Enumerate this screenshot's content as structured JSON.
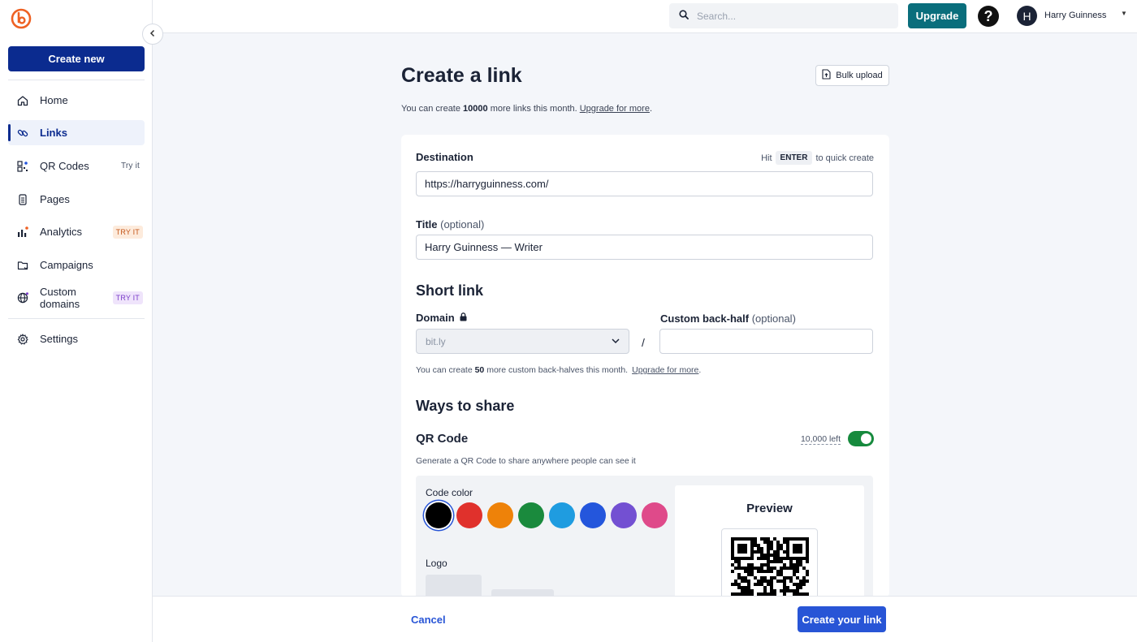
{
  "sidebar": {
    "create_label": "Create new",
    "items": [
      {
        "label": "Home",
        "icon": "home-icon"
      },
      {
        "label": "Links",
        "icon": "link-icon",
        "active": true
      },
      {
        "label": "QR Codes",
        "icon": "qr-code-icon",
        "badge": "Try it"
      },
      {
        "label": "Pages",
        "icon": "page-icon"
      },
      {
        "label": "Analytics",
        "icon": "chart-icon",
        "badge": "TRY IT"
      },
      {
        "label": "Campaigns",
        "icon": "campaign-icon"
      },
      {
        "label": "Custom domains",
        "icon": "globe-icon",
        "badge": "TRY IT"
      },
      {
        "label": "Settings",
        "icon": "gear-icon"
      }
    ]
  },
  "header": {
    "search_placeholder": "Search...",
    "upgrade_label": "Upgrade",
    "help_glyph": "?",
    "avatar_initial": "H",
    "user_name": "Harry Guinness"
  },
  "main": {
    "title": "Create a link",
    "bulk_upload_label": "Bulk upload",
    "quota": {
      "prefix": "You can create ",
      "count": "10000",
      "suffix": " more links this month. ",
      "link": "Upgrade for more",
      "end": "."
    }
  },
  "form": {
    "destination_label": "Destination",
    "hint_prefix": "Hit",
    "hint_key": "ENTER",
    "hint_suffix": "to quick create",
    "destination_value": "https://harryguinness.com/",
    "title_label": "Title",
    "title_optional": "(optional)",
    "title_value": "Harry Guinness — Writer",
    "short_link_heading": "Short link",
    "domain_label": "Domain",
    "domain_value": "bit.ly",
    "slash": "/",
    "backhalf_label": "Custom back-half",
    "backhalf_optional": "(optional)",
    "backhalf_value": "",
    "backhalf_note": {
      "prefix": "You can create ",
      "count": "50",
      "suffix": " more custom back-halves this month.",
      "link": "Upgrade for more",
      "end": "."
    },
    "ways_heading": "Ways to share",
    "qr_title": "QR Code",
    "qr_left": "10,000 left",
    "qr_enabled": true,
    "qr_desc": "Generate a QR Code to share anywhere people can see it",
    "code_color_label": "Code color",
    "colors": [
      "#000000",
      "#e0312c",
      "#ee8209",
      "#1a8a3d",
      "#1f9ce0",
      "#2456dc",
      "#7350d2",
      "#df4a8a"
    ],
    "selected_color": "#000000",
    "logo_label": "Logo",
    "preview_title": "Preview"
  },
  "footer": {
    "cancel_label": "Cancel",
    "create_label": "Create your link"
  }
}
